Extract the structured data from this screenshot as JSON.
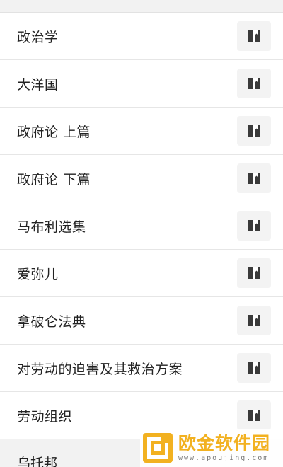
{
  "list": {
    "items": [
      {
        "label": "政治学"
      },
      {
        "label": "大洋国"
      },
      {
        "label": "政府论 上篇"
      },
      {
        "label": "政府论 下篇"
      },
      {
        "label": "马布利选集"
      },
      {
        "label": "爱弥儿"
      },
      {
        "label": "拿破仑法典"
      },
      {
        "label": "对劳动的迫害及其救治方案"
      },
      {
        "label": "劳动组织"
      }
    ],
    "partial_item": {
      "label": "乌托邦"
    }
  },
  "icons": {
    "row_action": "book-icon",
    "watermark_logo": "apoujing-logo"
  },
  "watermark": {
    "title": "欧金软件园",
    "url": "www.apoujing.com"
  },
  "colors": {
    "accent": "#f2b120",
    "text": "#222222",
    "icon": "#3a3a3a"
  }
}
